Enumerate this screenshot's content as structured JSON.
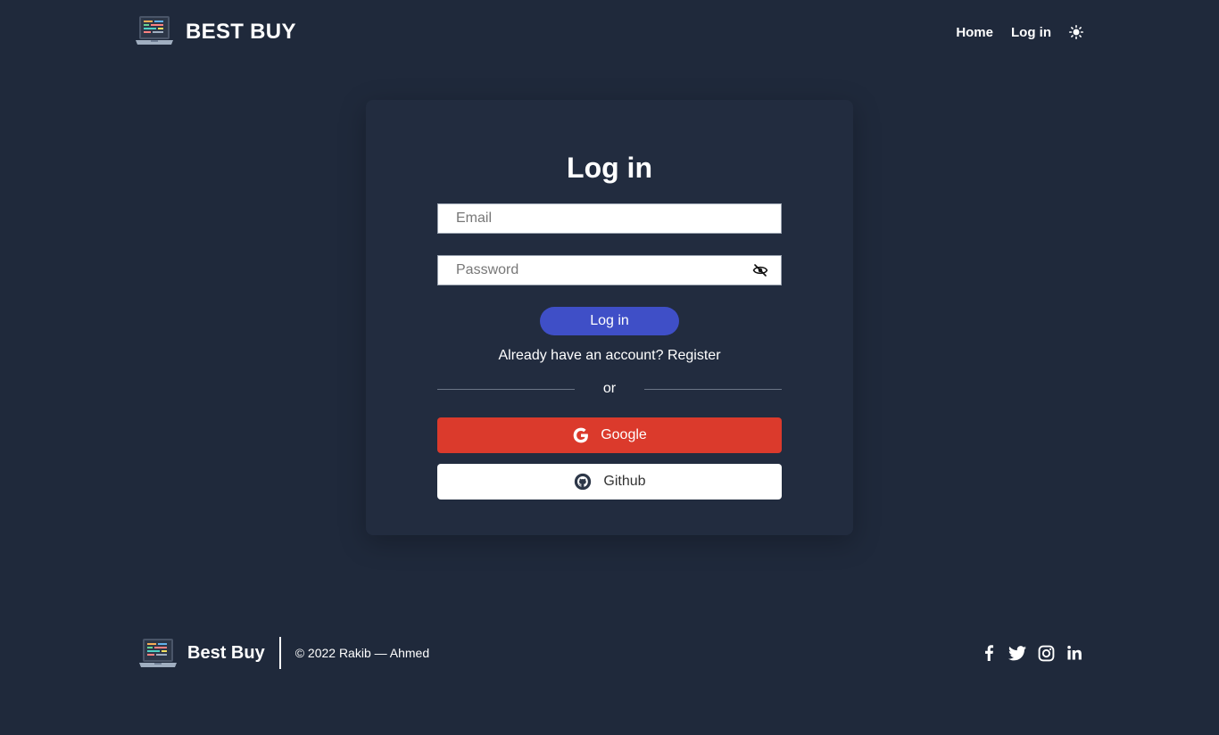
{
  "header": {
    "brand": "BEST BUY",
    "nav": {
      "home": "Home",
      "login": "Log in"
    }
  },
  "login_card": {
    "title": "Log in",
    "email_placeholder": "Email",
    "password_placeholder": "Password",
    "submit_label": "Log in",
    "register_prompt": "Already have an account?",
    "register_link": "Register",
    "divider_text": "or",
    "google_label": "Google",
    "github_label": "Github"
  },
  "footer": {
    "brand": "Best Buy",
    "copyright": "© 2022 Rakib — Ahmed"
  },
  "colors": {
    "background": "#1f293b",
    "card": "#222c3f",
    "primary_button": "#3f4fc7",
    "google_button": "#db3a2c"
  },
  "icons": [
    "laptop-logo-icon",
    "sun-icon",
    "eye-off-icon",
    "google-icon",
    "github-icon",
    "facebook-icon",
    "twitter-icon",
    "instagram-icon",
    "linkedin-icon"
  ]
}
